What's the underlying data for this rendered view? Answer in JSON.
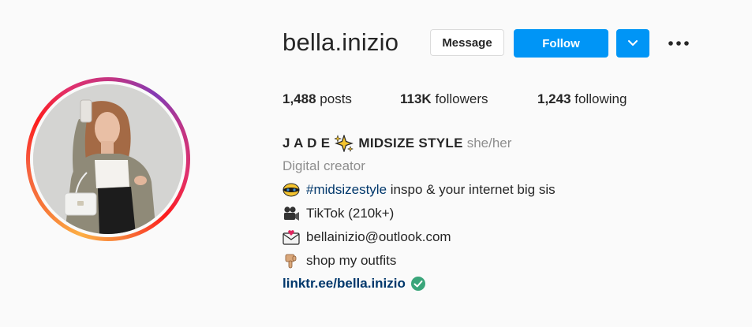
{
  "profile": {
    "username": "bella.inizio",
    "display_name": "J A D E",
    "display_name_suffix": "MIDSIZE STYLE",
    "pronouns": "she/her",
    "category": "Digital creator"
  },
  "actions": {
    "message_label": "Message",
    "follow_label": "Follow"
  },
  "stats": {
    "posts_count": "1,488",
    "posts_label": "posts",
    "followers_count": "113K",
    "followers_label": "followers",
    "following_count": "1,243",
    "following_label": "following"
  },
  "bio": {
    "line1_hashtag": "#midsizestyle",
    "line1_text": " inspo & your internet big sis",
    "line2_text": "TikTok (210k+)",
    "line3_text": "bellainizio@outlook.com",
    "line4_text": "shop my outfits",
    "link_text": "linktr.ee/bella.inizio"
  },
  "icons": {
    "line1": "dizzy-face-emoji",
    "line2": "video-camera-emoji",
    "line3": "envelope-heart-emoji",
    "line4": "pointing-down-emoji",
    "name_sparkle": "sparkles-emoji",
    "link_badge": "check-circle-icon"
  },
  "colors": {
    "follow_blue": "#0095f6",
    "link_blue": "#00376b",
    "muted_gray": "#8e8e8e",
    "verified_green": "#3aa57a"
  }
}
